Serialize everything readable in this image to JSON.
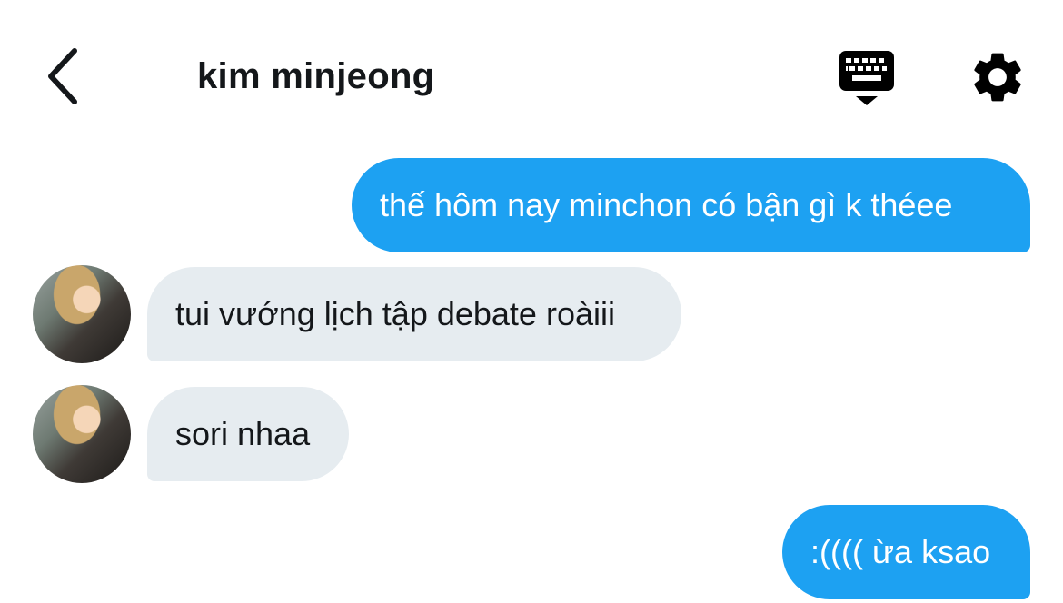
{
  "header": {
    "title": "kim minjeong",
    "back_icon": "chevron-left-icon",
    "keyboard_icon": "keyboard-icon",
    "settings_icon": "gear-icon"
  },
  "colors": {
    "outgoing_bubble": "#1da1f2",
    "incoming_bubble": "#e6ecf0",
    "title_text": "#14171a"
  },
  "messages": [
    {
      "direction": "outgoing",
      "text": "thế hôm nay minchon có bận gì k théee"
    },
    {
      "direction": "incoming",
      "text": "tui vướng lịch tập debate roàiii"
    },
    {
      "direction": "incoming",
      "text": "sori nhaa"
    },
    {
      "direction": "outgoing",
      "text": ":(((( ừa ksao"
    }
  ]
}
